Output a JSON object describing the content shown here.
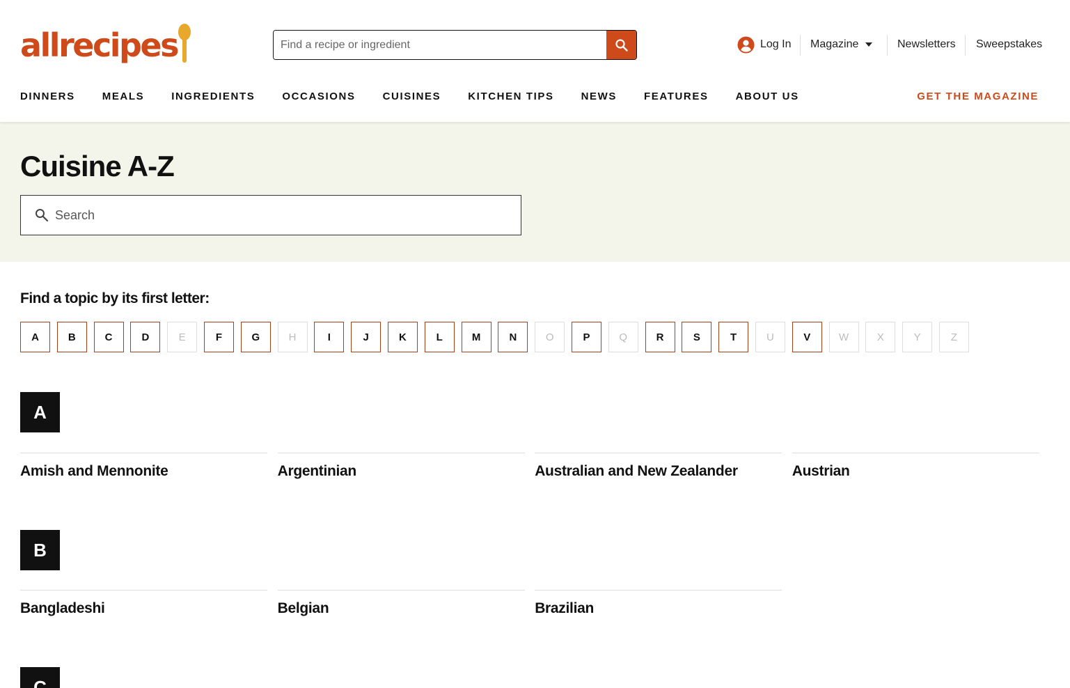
{
  "brand": {
    "logo_text": "allrecipes",
    "colors": {
      "accent": "#ce4a1a",
      "spoon": "#e8a82b",
      "hero_bg": "#f4f5ea",
      "badge_bg": "#111111"
    }
  },
  "header": {
    "search": {
      "placeholder": "Find a recipe or ingredient",
      "button_icon": "search-icon"
    },
    "utility": {
      "login_label": "Log In",
      "login_icon": "user-circle-icon",
      "magazine_label": "Magazine",
      "newsletters_label": "Newsletters",
      "sweepstakes_label": "Sweepstakes"
    },
    "nav": [
      "DINNERS",
      "MEALS",
      "INGREDIENTS",
      "OCCASIONS",
      "CUISINES",
      "KITCHEN TIPS",
      "NEWS",
      "FEATURES",
      "ABOUT US"
    ],
    "cta_label": "GET THE MAGAZINE"
  },
  "hero": {
    "title": "Cuisine A-Z",
    "search_placeholder": "Search"
  },
  "index": {
    "title": "Find a topic by its first letter:",
    "letters": [
      {
        "l": "A",
        "on": true
      },
      {
        "l": "B",
        "on": true
      },
      {
        "l": "C",
        "on": true
      },
      {
        "l": "D",
        "on": true
      },
      {
        "l": "E",
        "on": false
      },
      {
        "l": "F",
        "on": true
      },
      {
        "l": "G",
        "on": true
      },
      {
        "l": "H",
        "on": false
      },
      {
        "l": "I",
        "on": true
      },
      {
        "l": "J",
        "on": true
      },
      {
        "l": "K",
        "on": true
      },
      {
        "l": "L",
        "on": true
      },
      {
        "l": "M",
        "on": true
      },
      {
        "l": "N",
        "on": true
      },
      {
        "l": "O",
        "on": false
      },
      {
        "l": "P",
        "on": true
      },
      {
        "l": "Q",
        "on": false
      },
      {
        "l": "R",
        "on": true
      },
      {
        "l": "S",
        "on": true
      },
      {
        "l": "T",
        "on": true
      },
      {
        "l": "U",
        "on": false
      },
      {
        "l": "V",
        "on": true
      },
      {
        "l": "W",
        "on": false
      },
      {
        "l": "X",
        "on": false
      },
      {
        "l": "Y",
        "on": false
      },
      {
        "l": "Z",
        "on": false
      }
    ]
  },
  "sections": [
    {
      "letter": "A",
      "topics": [
        "Amish and Mennonite",
        "Argentinian",
        "Australian and New Zealander",
        "Austrian"
      ]
    },
    {
      "letter": "B",
      "topics": [
        "Bangladeshi",
        "Belgian",
        "Brazilian"
      ]
    },
    {
      "letter": "C",
      "topics": []
    }
  ]
}
